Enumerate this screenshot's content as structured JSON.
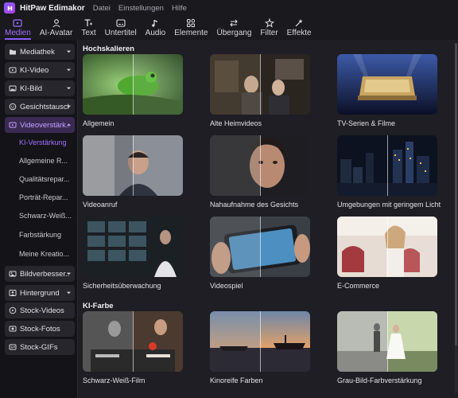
{
  "titlebar": {
    "app_title": "HitPaw Edimakor",
    "menus": [
      "Datei",
      "Einstellungen",
      "Hilfe"
    ]
  },
  "toolbar": {
    "tools": [
      {
        "label": "Medien",
        "icon": "media-icon",
        "active": true
      },
      {
        "label": "AI-Avatar",
        "icon": "ai-avatar-icon",
        "active": false
      },
      {
        "label": "Text",
        "icon": "text-icon",
        "active": false
      },
      {
        "label": "Untertitel",
        "icon": "subtitle-icon",
        "active": false
      },
      {
        "label": "Audio",
        "icon": "audio-icon",
        "active": false
      },
      {
        "label": "Elemente",
        "icon": "elements-icon",
        "active": false
      },
      {
        "label": "Übergang",
        "icon": "transition-icon",
        "active": false
      },
      {
        "label": "Filter",
        "icon": "filter-icon",
        "active": false
      },
      {
        "label": "Effekte",
        "icon": "effects-icon",
        "active": false
      }
    ],
    "accent": "#8b5cf6"
  },
  "sidebar": {
    "items": [
      {
        "label": "Mediathek",
        "icon": "folder-icon"
      },
      {
        "label": "KI-Video",
        "icon": "ai-video-icon"
      },
      {
        "label": "KI-Bild",
        "icon": "ai-image-icon"
      },
      {
        "label": "Gesichtstausch",
        "icon": "face-swap-icon"
      },
      {
        "label": "Videoverstärk...",
        "icon": "video-enhance-icon",
        "expanded": true
      },
      {
        "label": "Bildverbesser...",
        "icon": "image-enhance-icon"
      },
      {
        "label": "Hintergrund",
        "icon": "background-icon"
      },
      {
        "label": "Stock-Videos",
        "icon": "stock-video-icon"
      },
      {
        "label": "Stock-Fotos",
        "icon": "stock-photo-icon"
      },
      {
        "label": "Stock-GIFs",
        "icon": "stock-gif-icon"
      }
    ],
    "subitems": [
      {
        "label": "KI-Verstärkung",
        "active": true
      },
      {
        "label": "Allgemeine R...",
        "active": false
      },
      {
        "label": "Qualitätsrepar...",
        "active": false
      },
      {
        "label": "Porträt-Repar...",
        "active": false
      },
      {
        "label": "Schwarz-Weiß...",
        "active": false
      },
      {
        "label": "Farbstärkung",
        "active": false
      },
      {
        "label": "Meine Kreatio...",
        "active": false
      }
    ]
  },
  "content": {
    "sections": [
      {
        "title": "Hochskalieren",
        "cards": [
          {
            "label": "Allgemein",
            "thumb": "frog"
          },
          {
            "label": "Alte Heimvideos",
            "thumb": "home"
          },
          {
            "label": "TV-Serien & Filme",
            "thumb": "logo"
          },
          {
            "label": "Videoanruf",
            "thumb": "call"
          },
          {
            "label": "Nahaufnahme des Gesichts",
            "thumb": "face"
          },
          {
            "label": "Umgebungen mit geringem Licht",
            "thumb": "city"
          },
          {
            "label": "Sicherheitsüberwachung",
            "thumb": "cctv"
          },
          {
            "label": "Videospiel",
            "thumb": "game"
          },
          {
            "label": "E-Commerce",
            "thumb": "shop"
          }
        ]
      },
      {
        "title": "KI-Farbe",
        "cards": [
          {
            "label": "Schwarz-Weiß-Film",
            "thumb": "bw"
          },
          {
            "label": "Kinoreife Farben",
            "thumb": "sunset"
          },
          {
            "label": "Grau-Bild-Farbverstärkung",
            "thumb": "wedding"
          }
        ]
      }
    ]
  }
}
